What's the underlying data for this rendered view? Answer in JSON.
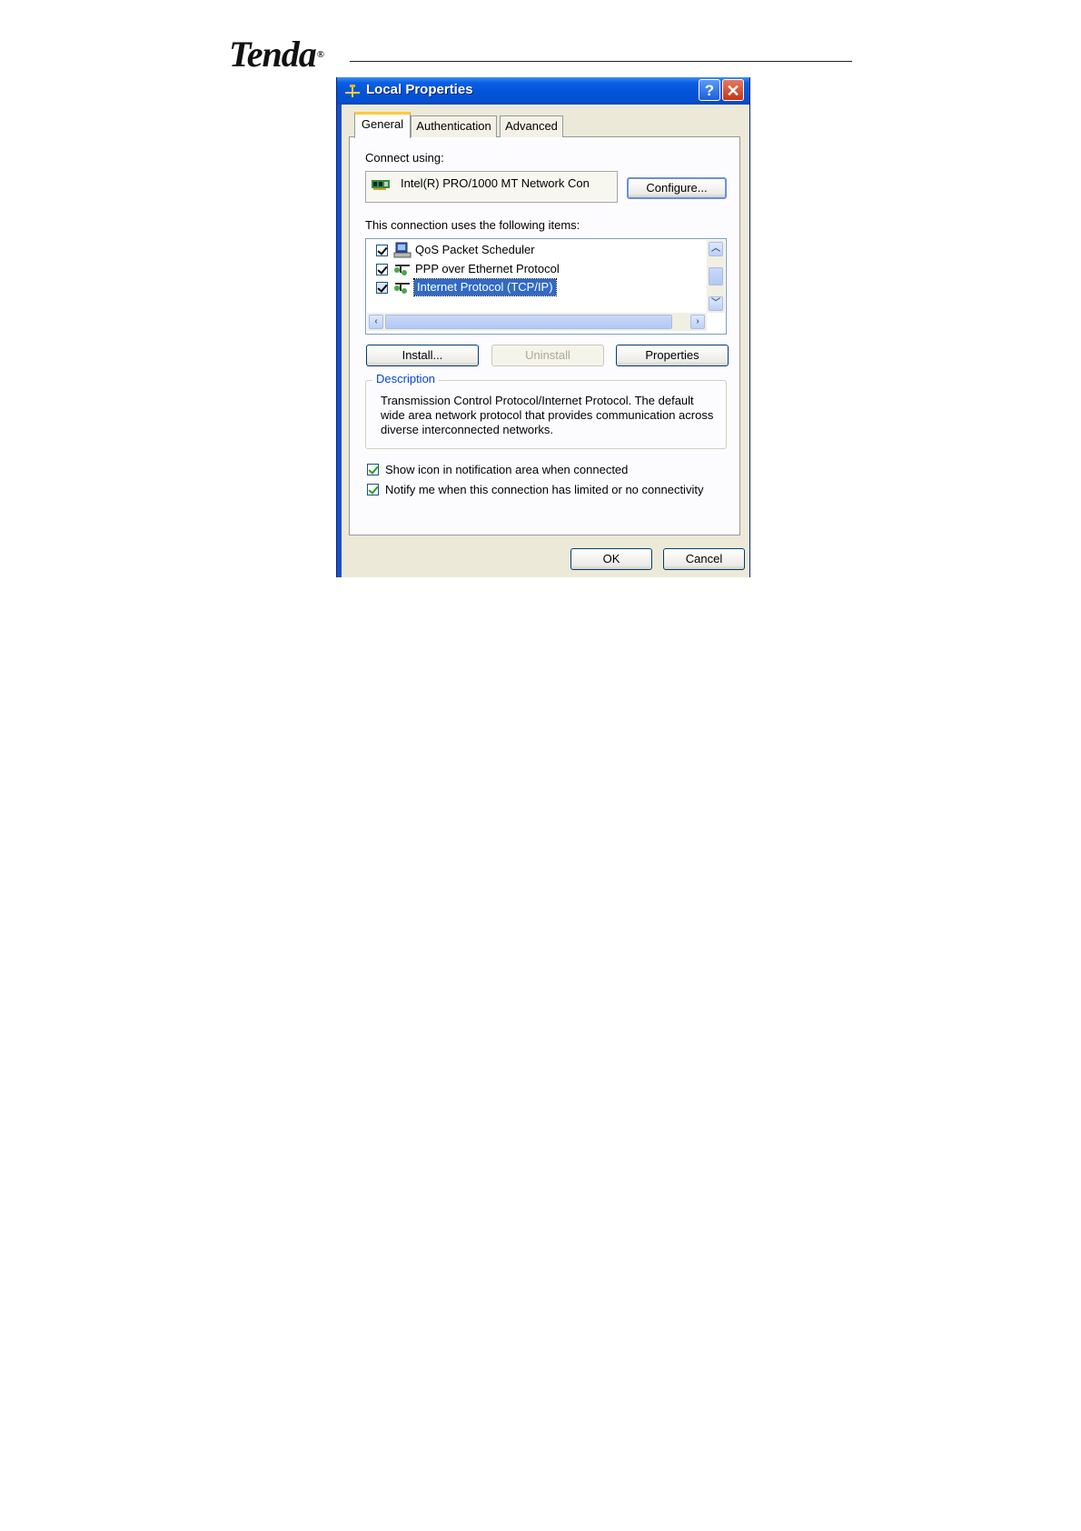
{
  "brand": {
    "name": "Tenda",
    "mark": "®"
  },
  "dialog": {
    "title": "Local Properties",
    "help_glyph": "?",
    "close_glyph": "✕",
    "tabs": [
      {
        "label": "General",
        "active": true
      },
      {
        "label": "Authentication",
        "active": false
      },
      {
        "label": "Advanced",
        "active": false
      }
    ],
    "connect_using_label": "Connect using:",
    "adapter_name": "Intel(R) PRO/1000 MT Network Con",
    "configure_label": "Configure...",
    "items_label": "This connection uses the following items:",
    "items": [
      {
        "label": "QoS Packet Scheduler",
        "checked": true,
        "selected": false,
        "icon": "computer-icon"
      },
      {
        "label": "PPP over Ethernet Protocol",
        "checked": true,
        "selected": false,
        "icon": "network-protocol-icon"
      },
      {
        "label": "Internet Protocol (TCP/IP)",
        "checked": true,
        "selected": true,
        "icon": "network-protocol-icon"
      }
    ],
    "install_label": "Install...",
    "uninstall_label": "Uninstall",
    "properties_label": "Properties",
    "description_legend": "Description",
    "description_text": "Transmission Control Protocol/Internet Protocol. The default wide area network protocol that provides communication across diverse interconnected networks.",
    "show_icon_label": "Show icon in notification area when connected",
    "show_icon_checked": true,
    "notify_label": "Notify me when this connection has limited or no connectivity",
    "notify_checked": true,
    "ok_label": "OK",
    "cancel_label": "Cancel"
  }
}
